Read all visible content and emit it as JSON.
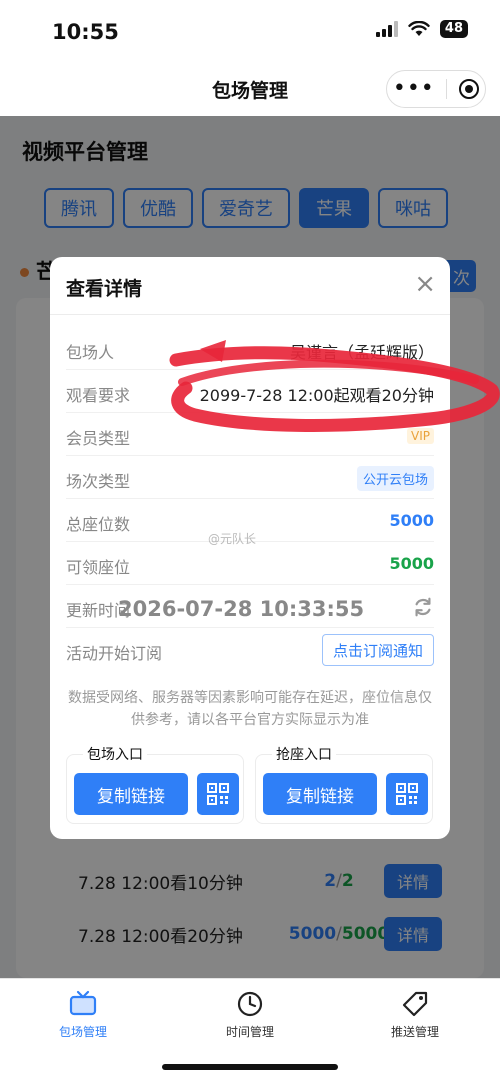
{
  "status_bar": {
    "time": "10:55",
    "battery": "48"
  },
  "nav": {
    "title": "包场管理",
    "more_icon": "more-dots-icon",
    "target_icon": "target-icon"
  },
  "page": {
    "section_title": "视频平台管理",
    "platform_tabs": [
      {
        "label": "腾讯",
        "active": false
      },
      {
        "label": "优酷",
        "active": false
      },
      {
        "label": "爱奇艺",
        "active": false
      },
      {
        "label": "芒果",
        "active": true
      },
      {
        "label": "咪咕",
        "active": false
      }
    ],
    "header_fragment": "芒",
    "header_button_fragment": "次",
    "sessions": [
      {
        "label": "7.28 12:00看10分钟",
        "used": "2",
        "total": "2",
        "button": "详情"
      },
      {
        "label": "7.28 12:00看20分钟",
        "used": "5000",
        "total": "5000",
        "button": "详情"
      }
    ]
  },
  "modal": {
    "title": "查看详情",
    "close": "×",
    "rows": [
      {
        "label": "包场人",
        "value": "吴谨言（孟廷辉版）",
        "style": "plain"
      },
      {
        "label": "观看要求",
        "value": "2099-7-28 12:00起观看20分钟",
        "style": "plain"
      },
      {
        "label": "会员类型",
        "value": "VIP",
        "style": "vip"
      },
      {
        "label": "场次类型",
        "value": "公开云包场",
        "style": "tag"
      },
      {
        "label": "总座位数",
        "value": "5000",
        "style": "blue"
      },
      {
        "label": "可领座位",
        "value": "5000",
        "style": "green"
      }
    ],
    "update_time": {
      "label": "更新时间",
      "value": "2026-07-28 10:33:55"
    },
    "subscribe": {
      "label": "活动开始订阅",
      "button": "点击订阅通知"
    },
    "notice": "数据受网络、服务器等因素影响可能存在延迟，座位信息仅供参考，请以各平台官方实际显示为准",
    "entries": [
      {
        "label": "包场入口",
        "button": "复制链接"
      },
      {
        "label": "抢座入口",
        "button": "复制链接"
      }
    ]
  },
  "watermark": "@元队长",
  "tab_bar": [
    {
      "label": "包场管理",
      "icon": "tv-icon",
      "active": true
    },
    {
      "label": "时间管理",
      "icon": "clock-icon",
      "active": false
    },
    {
      "label": "推送管理",
      "icon": "tag-icon",
      "active": false
    }
  ],
  "colors": {
    "primary": "#2f7ff7",
    "green": "#19a34a",
    "annotation": "#e8263a"
  }
}
